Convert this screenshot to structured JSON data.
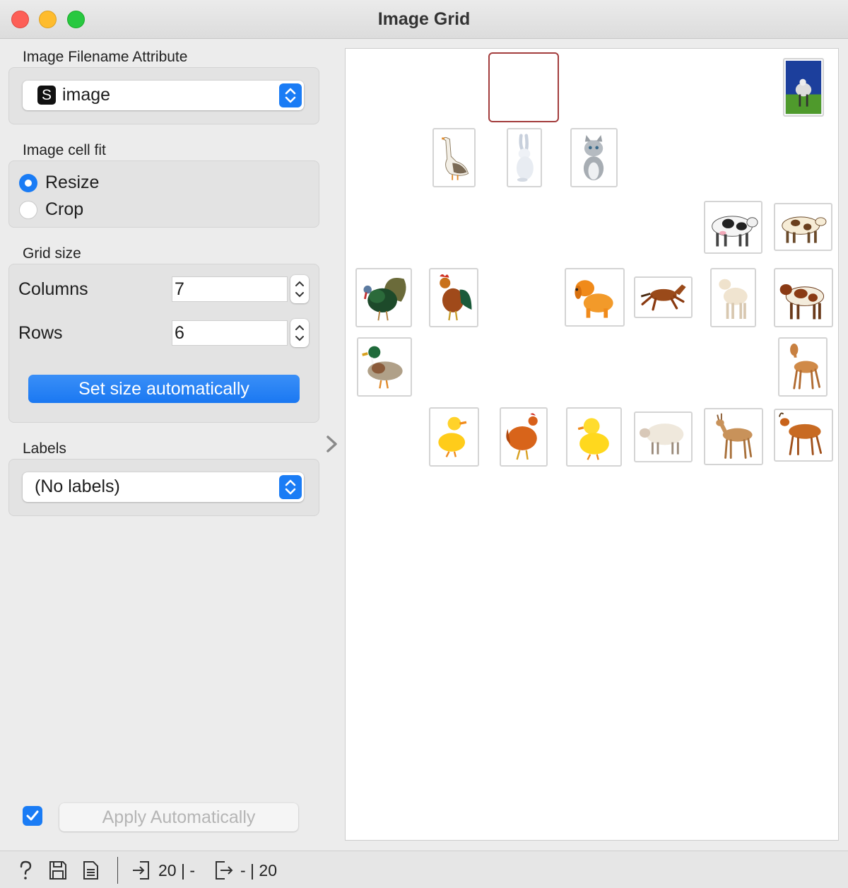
{
  "window": {
    "title": "Image Grid",
    "controls": [
      "close",
      "minimize",
      "zoom"
    ]
  },
  "filename_attribute": {
    "label": "Image Filename Attribute",
    "type_badge": "S",
    "value": "image"
  },
  "cell_fit": {
    "label": "Image cell fit",
    "options": [
      {
        "label": "Resize",
        "selected": true
      },
      {
        "label": "Crop",
        "selected": false
      }
    ]
  },
  "grid_size": {
    "label": "Grid size",
    "columns_label": "Columns",
    "columns_value": "7",
    "rows_label": "Rows",
    "rows_value": "6",
    "auto_button": "Set size automatically"
  },
  "labels": {
    "label": "Labels",
    "value": "(No labels)"
  },
  "apply": {
    "checked": true,
    "button": "Apply Automatically"
  },
  "image_grid": {
    "images": [
      {
        "animal": "empty (selected)"
      },
      {
        "animal": "cow on meadow (photo)"
      },
      {
        "animal": "goose"
      },
      {
        "animal": "rabbit"
      },
      {
        "animal": "kitten"
      },
      {
        "animal": "cow"
      },
      {
        "animal": "cow"
      },
      {
        "animal": "turkey"
      },
      {
        "animal": "rooster"
      },
      {
        "animal": "puppy"
      },
      {
        "animal": "horse"
      },
      {
        "animal": "lamb"
      },
      {
        "animal": "cow"
      },
      {
        "animal": "duck"
      },
      {
        "animal": "foal"
      },
      {
        "animal": "duckling"
      },
      {
        "animal": "hen"
      },
      {
        "animal": "chick"
      },
      {
        "animal": "sheep"
      },
      {
        "animal": "deer"
      },
      {
        "animal": "goat"
      }
    ]
  },
  "status": {
    "input_summary": "20 | -",
    "output_summary": "- | 20"
  },
  "colors": {
    "accent": "#1a7cf5",
    "selection": "#a33d3d",
    "window_bg": "#ececec"
  }
}
